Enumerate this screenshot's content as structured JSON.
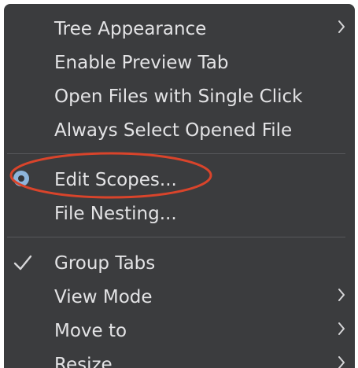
{
  "menu": {
    "items": [
      {
        "label": "Tree Appearance",
        "submenu": true
      },
      {
        "label": "Enable Preview Tab"
      },
      {
        "label": "Open Files with Single Click"
      },
      {
        "label": "Always Select Opened File"
      },
      {
        "label": "Edit Scopes...",
        "radio_selected": true
      },
      {
        "label": "File Nesting..."
      },
      {
        "label": "Group Tabs",
        "checked": true
      },
      {
        "label": "View Mode",
        "submenu": true
      },
      {
        "label": "Move to",
        "submenu": true
      },
      {
        "label": "Resize",
        "submenu": true
      }
    ]
  },
  "colors": {
    "menu_background": "#3b3c3e",
    "text": "#e3e3e5",
    "separator": "#57585b",
    "radio_accent": "#8eb5dc",
    "annotation": "#d9442b"
  },
  "icons": {
    "submenu": "chevron-right-icon",
    "radio": "radio-selected-icon",
    "check": "checkmark-icon"
  }
}
